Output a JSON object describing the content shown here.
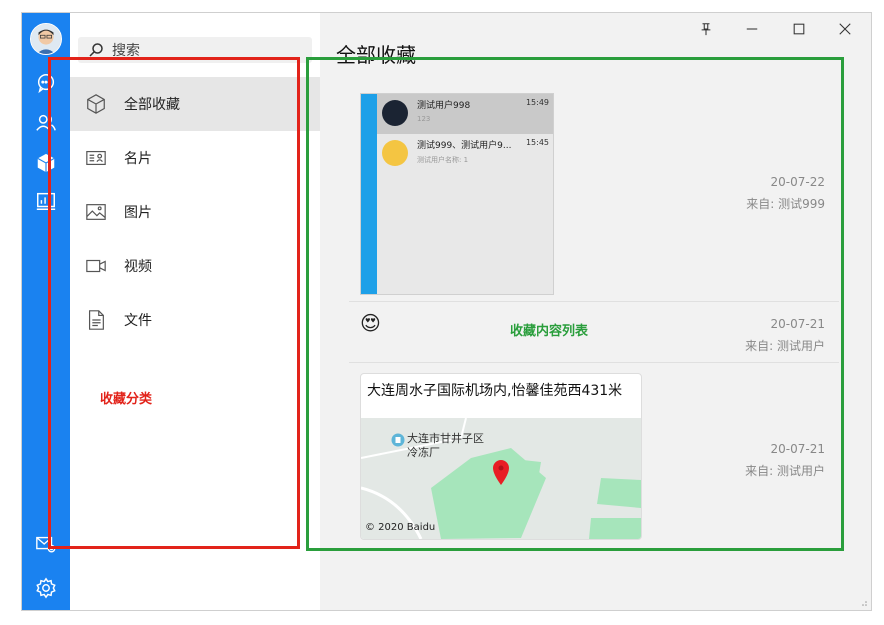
{
  "search": {
    "placeholder": "搜索"
  },
  "categories": [
    {
      "label": "全部收藏",
      "icon": "cube-icon"
    },
    {
      "label": "名片",
      "icon": "contact-card-icon"
    },
    {
      "label": "图片",
      "icon": "image-icon"
    },
    {
      "label": "视频",
      "icon": "video-icon"
    },
    {
      "label": "文件",
      "icon": "document-icon"
    }
  ],
  "annotations": {
    "categories": "收藏分类",
    "content_list": "收藏内容列表"
  },
  "content": {
    "title": "全部收藏",
    "items": [
      {
        "date": "20-07-22",
        "source": "来自: 测试999",
        "screenshot": {
          "rows": [
            {
              "name": "测试用户998",
              "sub": "123",
              "time": "15:49"
            },
            {
              "name": "测试999、测试用户9...",
              "sub": "测试用户名称: 1",
              "time": "15:45"
            }
          ]
        }
      },
      {
        "date": "20-07-21",
        "source": "来自: 测试用户",
        "emoji": "😍"
      },
      {
        "date": "20-07-21",
        "source": "来自: 测试用户",
        "location": {
          "title": "大连周水子国际机场内,怡馨佳苑西431米",
          "label1": "大连市甘井子区",
          "label2": "冷冻厂",
          "copyright": "© 2020 Baidu"
        }
      }
    ]
  },
  "colors": {
    "nav": "#1a82f0",
    "annotation_red": "#e2231a",
    "annotation_green": "#2a9e3c"
  }
}
